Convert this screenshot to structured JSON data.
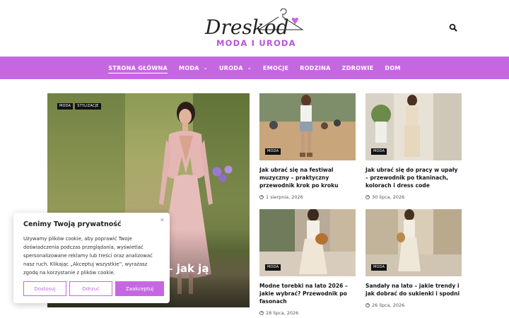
{
  "site": {
    "logo_script": "Dreskod",
    "logo_subtitle": "MODA I URODA"
  },
  "nav": {
    "items": [
      {
        "label": "STRONA GŁÓWNA",
        "active": true,
        "dropdown": false
      },
      {
        "label": "MODA",
        "active": false,
        "dropdown": true
      },
      {
        "label": "URODA",
        "active": false,
        "dropdown": true
      },
      {
        "label": "EMOCJE",
        "active": false,
        "dropdown": false
      },
      {
        "label": "RODZINA",
        "active": false,
        "dropdown": false
      },
      {
        "label": "ZDROWIE",
        "active": false,
        "dropdown": false
      },
      {
        "label": "DOM",
        "active": false,
        "dropdown": false
      }
    ]
  },
  "hero": {
    "tags": [
      "MODA",
      "STYLIZACJE"
    ],
    "title_visible": "– jak ją"
  },
  "cards": [
    {
      "tag": "MODA",
      "title": "Jak ubrać się na festiwal muzyczny – praktyczny przewodnik krok po kroku",
      "date": "1 sierpnia, 2026"
    },
    {
      "tag": "MODA",
      "title": "Jak ubrać się do pracy w upały – przewodnik po tkaninach, kolorach i dress code",
      "date": "30 lipca, 2026"
    },
    {
      "tag": "MODA",
      "title": "Modne torebki na lato 2026 – jakie wybrać? Przewodnik po fasonach",
      "date": "28 lipca, 2026"
    },
    {
      "tag": "MODA",
      "title": "Sandały na lato – jakie trendy i jak dobrać do sukienki i spodni",
      "date": "26 lipca, 2026"
    }
  ],
  "cookie": {
    "title": "Cenimy Twoją prywatność",
    "text": "Używamy plików cookie, aby poprawić Twoje doświadczenia podczas przeglądania, wyświetlać spersonalizowane reklamy lub treści oraz analizować nasz ruch. Klikając „Akceptuj wszystkie”, wyrażasz zgodę na korzystanie z plików cookie.",
    "close": "×",
    "buttons": {
      "customize": "Dostosuj",
      "reject": "Odrzuć",
      "accept": "Zaakceptuj"
    }
  },
  "colors": {
    "accent": "#c667e2",
    "logo_accent": "#b855d9"
  },
  "icons": [
    "search-icon",
    "hanger-icon",
    "heart-icon",
    "clock-icon",
    "chevron-down-icon",
    "close-icon"
  ]
}
